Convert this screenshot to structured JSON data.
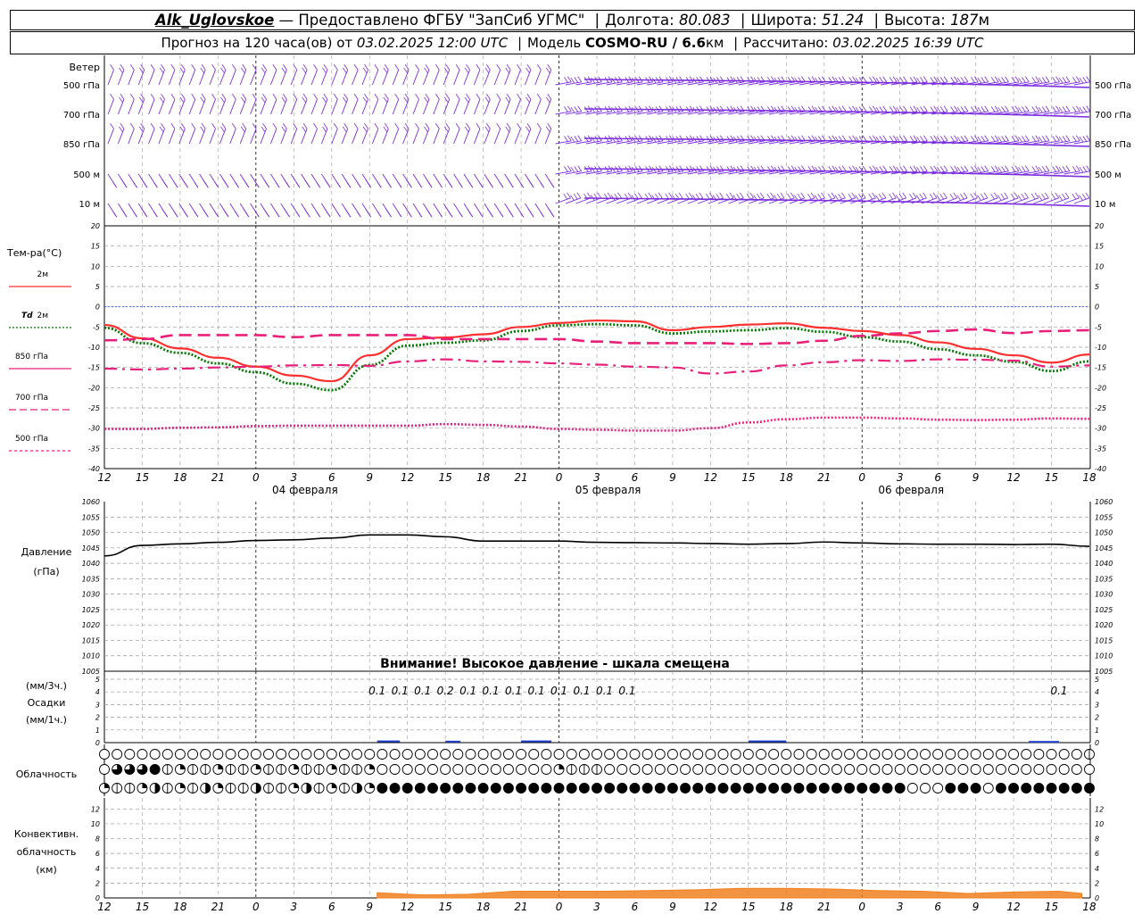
{
  "header": {
    "station": "Alk_Uglovskoe",
    "dash": " — ",
    "provider": "Предоставлено ФГБУ \"ЗапСиб УГМС\"",
    "lon_label": "Долгота:",
    "lon": "80.083",
    "lat_label": "Широта:",
    "lat": "51.24",
    "alt_label": "Высота:",
    "alt": "187",
    "alt_unit": "м",
    "forecast_prefix": "Прогноз на 120 часа(ов) от",
    "forecast_time": "03.02.2025 12:00 UTC",
    "model_label": "Модель",
    "model": "COSMO-RU / 6.6",
    "model_unit": "км",
    "computed_label": "Рассчитано:",
    "computed_time": "03.02.2025 16:39 UTC"
  },
  "colors": {
    "wind": "#7a2ee0",
    "t2m": "#ff3030",
    "td2m": "#007700",
    "t850": "#e8207a",
    "t700": "#e8207a",
    "t500": "#e8207a",
    "pressure": "#000000",
    "precip": "#2040d0",
    "conv": "#f08020",
    "grid": "#9a9a9a",
    "zero": "#3050ff"
  },
  "wind_panel": {
    "title": "Ветер",
    "levels": [
      "500 гПа",
      "700 гПа",
      "850 гПа",
      "500 м",
      "10 м"
    ]
  },
  "temp_panel": {
    "title": "Тем-ра(°C)",
    "legend": [
      {
        "key": "t2m",
        "label": "2м"
      },
      {
        "key": "td2m",
        "label_pre": "Td",
        "label": "2м"
      },
      {
        "key": "t850",
        "label": "850 гПа"
      },
      {
        "key": "t700",
        "label": "700 гПа"
      },
      {
        "key": "t500",
        "label": "500 гПа"
      }
    ]
  },
  "pressure_panel": {
    "title": "Давление",
    "unit": "(гПа)",
    "warning": "Внимание! Высокое давление - шкала смещена"
  },
  "precip_panel": {
    "unit_3h": "(мм/3ч.)",
    "title": "Осадки",
    "unit_1h": "(мм/1ч.)"
  },
  "cloud_panel": {
    "title": "Облачность"
  },
  "conv_panel": {
    "title_1": "Конвективн.",
    "title_2": "облачность",
    "unit": "(км)"
  },
  "x_axis": {
    "hour_labels": [
      "12",
      "15",
      "18",
      "21",
      "0",
      "3",
      "6",
      "9",
      "12",
      "15",
      "18",
      "21",
      "0",
      "3",
      "6",
      "9",
      "12",
      "15",
      "18",
      "21",
      "0",
      "3",
      "6",
      "9",
      "12",
      "15",
      "18"
    ],
    "date_labels": [
      "04 февраля",
      "05 февраля",
      "06 февраля"
    ]
  },
  "chart_data": [
    {
      "type": "line",
      "title": "Тем-ра(°C)",
      "x": [
        0,
        3,
        6,
        9,
        12,
        15,
        18,
        21,
        24,
        27,
        30,
        33,
        36,
        39,
        42,
        45,
        48,
        51,
        54,
        57,
        60,
        63,
        66,
        69,
        72,
        75,
        78
      ],
      "ylim": [
        -40,
        20
      ],
      "yticks": [
        20,
        15,
        10,
        5,
        0,
        -5,
        -10,
        -15,
        -20,
        -25,
        -30,
        -35,
        -40
      ],
      "series": [
        {
          "name": "2м",
          "key": "t2m",
          "values": [
            -4.5,
            -7.8,
            -10.3,
            -12.6,
            -14.8,
            -17,
            -18.4,
            -12,
            -8,
            -7.6,
            -6.8,
            -5,
            -4,
            -3.4,
            -3.6,
            -5.8,
            -5,
            -4.4,
            -4.1,
            -5.2,
            -6,
            -7,
            -8.8,
            -10.4,
            -12,
            -13.8,
            -11.8
          ]
        },
        {
          "name": "Td 2м",
          "key": "td2m",
          "values": [
            -5.2,
            -9,
            -11.4,
            -14,
            -16.2,
            -19,
            -20.6,
            -14.4,
            -9.6,
            -8.9,
            -8.3,
            -6,
            -4.6,
            -4.3,
            -4.6,
            -6.6,
            -6.1,
            -5.8,
            -5.3,
            -6.2,
            -7.5,
            -8.6,
            -10.5,
            -12,
            -13.6,
            -15.9,
            -13.5
          ]
        },
        {
          "name": "850 гПа",
          "key": "t850",
          "values": [
            -8.3,
            -8,
            -7,
            -7,
            -7,
            -7.5,
            -7,
            -7,
            -7,
            -8,
            -8,
            -8,
            -8,
            -8.6,
            -9,
            -9,
            -9,
            -9.2,
            -9,
            -8.4,
            -7.2,
            -6.6,
            -6,
            -5.6,
            -6.5,
            -6,
            -5.8
          ]
        },
        {
          "name": "700 гПа",
          "key": "t700",
          "values": [
            -15.3,
            -15.5,
            -15.3,
            -15,
            -14.8,
            -14.5,
            -14.4,
            -14.6,
            -13.5,
            -13,
            -13.5,
            -13.6,
            -14,
            -14.3,
            -14.8,
            -15,
            -16.5,
            -16,
            -14.5,
            -13.7,
            -13.2,
            -13.4,
            -13,
            -13.1,
            -13.3,
            -14.8,
            -14.5
          ]
        },
        {
          "name": "500 гПа",
          "key": "t500",
          "values": [
            -30.2,
            -30.2,
            -29.9,
            -29.8,
            -29.5,
            -29.4,
            -29.4,
            -29.4,
            -29.4,
            -29,
            -29.2,
            -29.6,
            -30.2,
            -30.4,
            -30.6,
            -30.6,
            -30,
            -28.6,
            -27.8,
            -27.4,
            -27.4,
            -27.6,
            -27.9,
            -28,
            -27.9,
            -27.6,
            -27.7
          ]
        }
      ]
    },
    {
      "type": "line",
      "title": "Давление",
      "ylabel": "(гПа)",
      "x": [
        0,
        3,
        6,
        9,
        12,
        15,
        18,
        21,
        24,
        27,
        30,
        33,
        36,
        39,
        42,
        45,
        48,
        51,
        54,
        57,
        60,
        63,
        66,
        69,
        72,
        75,
        78
      ],
      "ylim": [
        1005,
        1060
      ],
      "yticks": [
        1060,
        1055,
        1050,
        1045,
        1040,
        1035,
        1030,
        1025,
        1020,
        1015,
        1010,
        1005
      ],
      "series": [
        {
          "name": "Давление",
          "key": "pressure",
          "values": [
            1042.4,
            1045.8,
            1046.3,
            1046.8,
            1047.4,
            1047.6,
            1048.2,
            1049.2,
            1049.2,
            1048.6,
            1047.2,
            1047.2,
            1047.2,
            1046.8,
            1046.7,
            1046.6,
            1046.4,
            1046.2,
            1046.4,
            1046.9,
            1046.6,
            1046.3,
            1046.2,
            1046.2,
            1046.1,
            1046.2,
            1045.5
          ]
        }
      ]
    },
    {
      "type": "bar",
      "title": "Осадки",
      "ylabel": "(мм/1ч.)",
      "ylim": [
        0,
        5
      ],
      "yticks": [
        5,
        4,
        3,
        2,
        1,
        0
      ],
      "labels_3h": [
        {
          "x_hour": 36,
          "text": "0.1"
        },
        {
          "x_hour": 39,
          "text": "0.1"
        },
        {
          "x_hour": 42,
          "text": "0.1"
        },
        {
          "x_hour": 45,
          "text": "0.2"
        },
        {
          "x_hour": 48,
          "text": "0.1"
        },
        {
          "x_hour": 51,
          "text": "0.1"
        },
        {
          "x_hour": 54,
          "text": "0.1"
        },
        {
          "x_hour": 57,
          "text": "0.1"
        },
        {
          "x_hour": 60,
          "text": "0.1"
        },
        {
          "x_hour": 63,
          "text": "0.1"
        },
        {
          "x_hour": 66,
          "text": "0.1"
        },
        {
          "x_hour": 69,
          "text": "0.1"
        },
        {
          "x_hour": 126,
          "text": "0.1"
        }
      ],
      "bars": [
        {
          "from_hour": 36,
          "to_hour": 39,
          "value": 0.1
        },
        {
          "from_hour": 45,
          "to_hour": 47,
          "value": 0.08
        },
        {
          "from_hour": 55,
          "to_hour": 59,
          "value": 0.1
        },
        {
          "from_hour": 85,
          "to_hour": 90,
          "value": 0.1
        },
        {
          "from_hour": 122,
          "to_hour": 126,
          "value": 0.05
        }
      ]
    },
    {
      "type": "area",
      "title": "Конвективн. облачность",
      "ylabel": "(км)",
      "ylim": [
        0,
        13
      ],
      "yticks": [
        12,
        10,
        8,
        6,
        4,
        2,
        0
      ],
      "x": [
        36,
        42,
        48,
        54,
        60,
        66,
        72,
        78,
        84,
        90,
        96,
        102,
        108,
        114,
        120,
        126,
        129
      ],
      "values": [
        0.7,
        0.4,
        0.5,
        0.9,
        0.9,
        0.9,
        1.0,
        1.1,
        1.3,
        1.3,
        1.2,
        1.0,
        0.9,
        0.6,
        0.8,
        0.9,
        0.6
      ]
    }
  ]
}
